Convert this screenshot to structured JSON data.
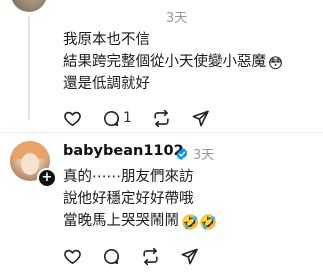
{
  "comment1": {
    "time": "3天",
    "lines": [
      "我原本也不信",
      "結果跨完整個從小天使變小惡魔",
      "還是低調就好"
    ],
    "line2_emoji": "😳",
    "counts": {
      "likes": "",
      "replies": "1",
      "reposts": "",
      "shares": ""
    }
  },
  "comment2": {
    "username": "babybean1102",
    "time": "3天",
    "lines": [
      "真的⋯⋯朋友們來訪",
      "說他好穩定好好帶哦",
      "當晚馬上哭哭鬧鬧"
    ],
    "line3_emoji": "🤣🤣"
  },
  "icons": {
    "like": "heart-icon",
    "reply": "comment-icon",
    "repost": "repost-icon",
    "share": "send-icon",
    "verified": "verified-badge-icon",
    "follow": "plus-icon"
  },
  "colors": {
    "verified": "#0095f6",
    "muted": "#999999",
    "text": "#1a1a1a"
  }
}
